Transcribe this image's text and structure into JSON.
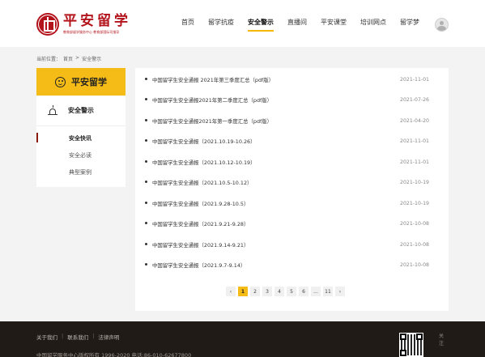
{
  "header": {
    "logo_title": "平安留学",
    "logo_subtitle": "教育部留学服务中心 教育部国际司指导",
    "nav": [
      {
        "label": "首页",
        "active": false
      },
      {
        "label": "留学抗疫",
        "active": false
      },
      {
        "label": "安全警示",
        "active": true
      },
      {
        "label": "直播间",
        "active": false
      },
      {
        "label": "平安课堂",
        "active": false
      },
      {
        "label": "培训网点",
        "active": false
      },
      {
        "label": "留学梦",
        "active": false
      }
    ],
    "avatar_icon": "user-avatar-icon"
  },
  "breadcrumb": {
    "prefix": "当前位置：",
    "home": "首页",
    "separator": ">",
    "current": "安全警示"
  },
  "sidebar": {
    "title": "平安留学",
    "title_icon": "smiley-icon",
    "section_label": "安全警示",
    "section_icon": "alarm-light-icon",
    "items": [
      {
        "label": "安全快讯",
        "active": true
      },
      {
        "label": "安全必读",
        "active": false
      },
      {
        "label": "典型案例",
        "active": false
      }
    ]
  },
  "articles": [
    {
      "title": "中国留学生安全通报 2021年第三季度汇总（pdf版）",
      "date": "2021-11-01"
    },
    {
      "title": "中国留学生安全通报2021年第二季度汇总（pdf版）",
      "date": "2021-07-26"
    },
    {
      "title": "中国留学生安全通报2021年第一季度汇总（pdf版）",
      "date": "2021-04-20"
    },
    {
      "title": "中国留学生安全通报（2021.10.19-10.26）",
      "date": "2021-11-01"
    },
    {
      "title": "中国留学生安全通报（2021.10.12-10.19）",
      "date": "2021-11-01"
    },
    {
      "title": "中国留学生安全通报（2021.10.5-10.12）",
      "date": "2021-10-19"
    },
    {
      "title": "中国留学生安全通报（2021.9.28-10.5）",
      "date": "2021-10-19"
    },
    {
      "title": "中国留学生安全通报（2021.9.21-9.28）",
      "date": "2021-10-08"
    },
    {
      "title": "中国留学生安全通报（2021.9.14-9.21）",
      "date": "2021-10-08"
    },
    {
      "title": "中国留学生安全通报（2021.9.7-9.14）",
      "date": "2021-10-08"
    }
  ],
  "pagination": {
    "prev": "‹",
    "pages": [
      "1",
      "2",
      "3",
      "4",
      "5",
      "6",
      "...",
      "11"
    ],
    "current": "1",
    "next": "›"
  },
  "footer": {
    "links": [
      "关于我们",
      "联系我们",
      "法律声明"
    ],
    "copyright": "中国留学服务中心版权所有  1996-2020 电话:86-010-62677800",
    "qr_side_text": "关注"
  },
  "colors": {
    "accent": "#f5bb16",
    "brand_red": "#b3141c",
    "footer_bg": "#211b17"
  }
}
